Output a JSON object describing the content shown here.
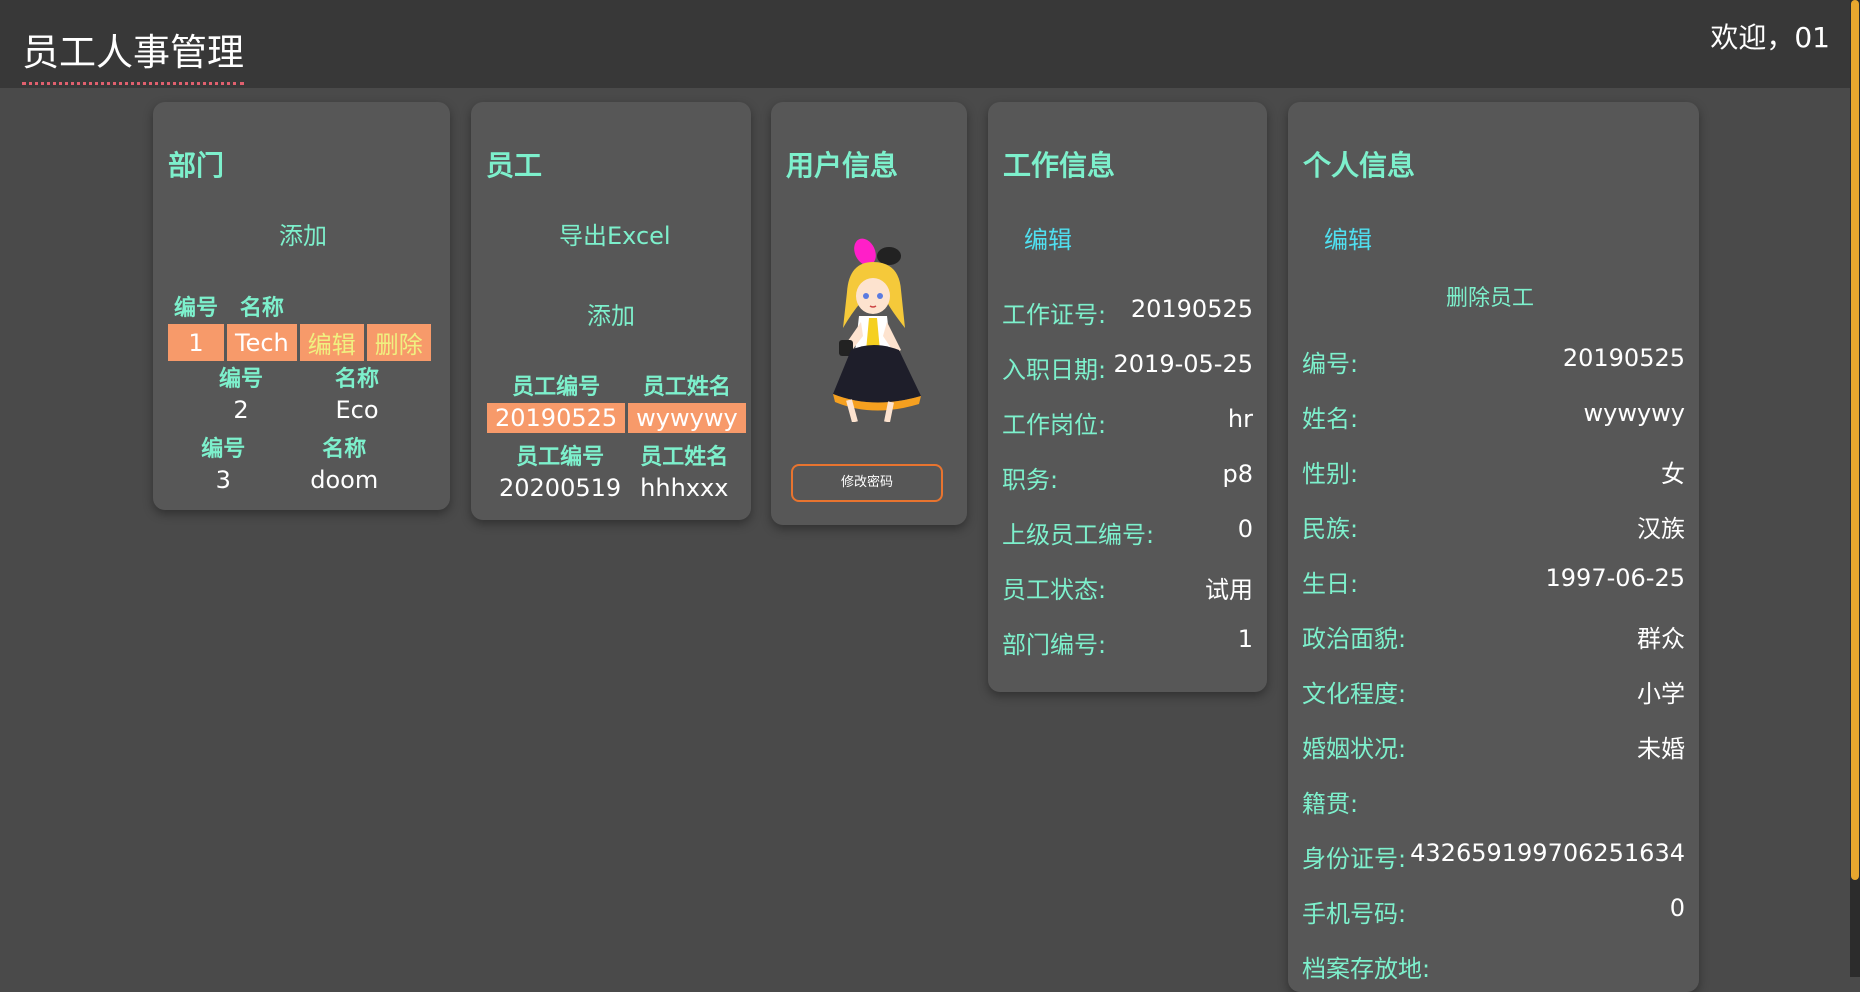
{
  "header": {
    "title": "员工人事管理",
    "welcome": "欢迎，01"
  },
  "department": {
    "title": "部门",
    "add": "添加",
    "col_id": "编号",
    "col_name": "名称",
    "rows": [
      {
        "id": "1",
        "name": "Tech",
        "edit": "编辑",
        "delete": "删除"
      },
      {
        "id": "2",
        "name": "Eco"
      },
      {
        "id": "3",
        "name": "doom"
      }
    ]
  },
  "employee": {
    "title": "员工",
    "export": "导出Excel",
    "add": "添加",
    "col_id": "员工编号",
    "col_name": "员工姓名",
    "rows": [
      {
        "id": "20190525",
        "name": "wywywy"
      },
      {
        "id": "20200519",
        "name": "hhhxxx"
      }
    ]
  },
  "user": {
    "title": "用户信息",
    "change_password": "修改密码"
  },
  "work": {
    "title": "工作信息",
    "edit": "编辑",
    "fields": [
      {
        "label": "工作证号:",
        "value": "20190525"
      },
      {
        "label": "入职日期:",
        "value": "2019-05-25"
      },
      {
        "label": "工作岗位:",
        "value": "hr"
      },
      {
        "label": "职务:",
        "value": "p8"
      },
      {
        "label": "上级员工编号:",
        "value": "0"
      },
      {
        "label": "员工状态:",
        "value": "试用"
      },
      {
        "label": "部门编号:",
        "value": "1"
      }
    ]
  },
  "personal": {
    "title": "个人信息",
    "edit": "编辑",
    "delete": "删除员工",
    "fields": [
      {
        "label": "编号:",
        "value": "20190525"
      },
      {
        "label": "姓名:",
        "value": "wywywy"
      },
      {
        "label": "性别:",
        "value": "女"
      },
      {
        "label": "民族:",
        "value": "汉族"
      },
      {
        "label": "生日:",
        "value": "1997-06-25"
      },
      {
        "label": "政治面貌:",
        "value": "群众"
      },
      {
        "label": "文化程度:",
        "value": "小学"
      },
      {
        "label": "婚姻状况:",
        "value": "未婚"
      },
      {
        "label": "籍贯:",
        "value": ""
      },
      {
        "label": "身份证号:",
        "value": "432659199706251634"
      },
      {
        "label": "手机号码:",
        "value": "0"
      },
      {
        "label": "档案存放地:",
        "value": ""
      }
    ]
  },
  "colors": {
    "accent": "#7df0cc",
    "highlight": "#f79a6a",
    "button_border": "#e8742f",
    "scroll": "#e8a72e"
  }
}
